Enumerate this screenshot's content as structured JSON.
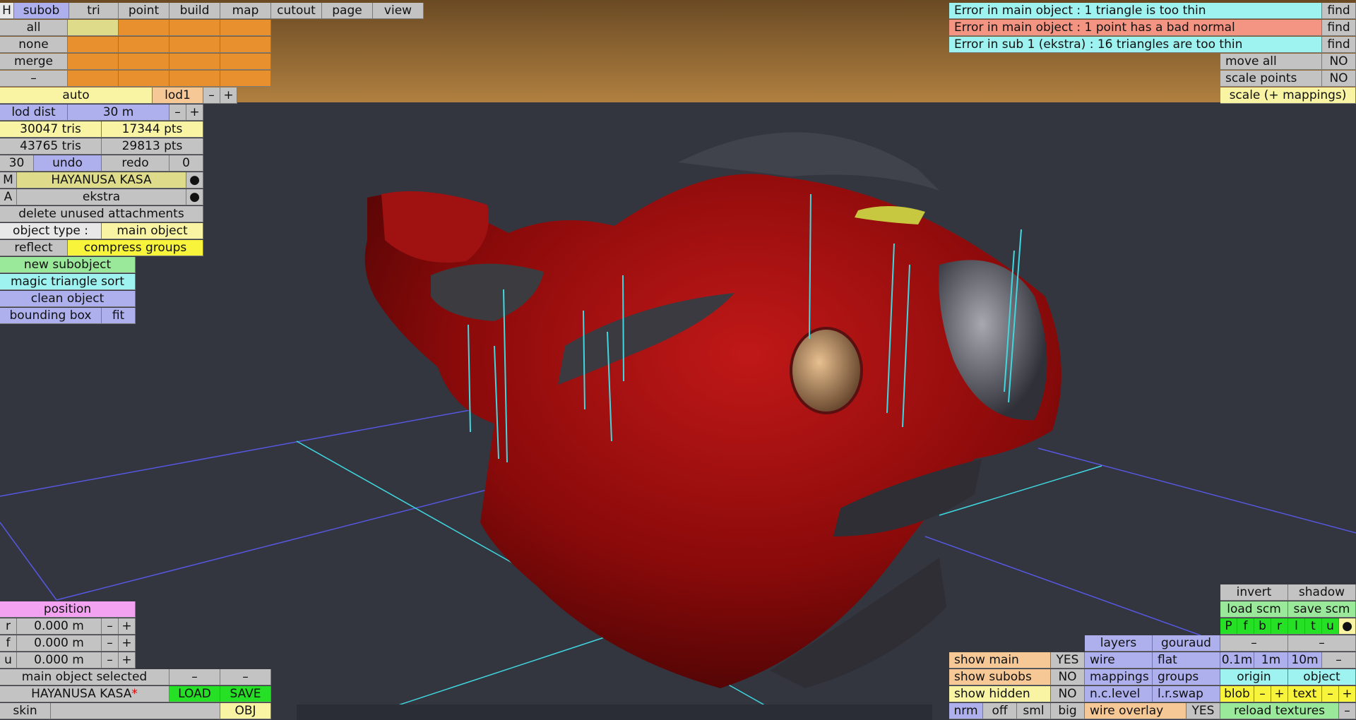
{
  "colors": {
    "background": "#33353f",
    "grid_blue": "#5658e0",
    "grid_cyan": "#40d8e0",
    "bike_red": "#8a0a0a",
    "sky_top": "#6a4a24",
    "sky_bottom": "#b08040"
  },
  "topmenu": {
    "h": "H",
    "items": [
      "subob",
      "tri",
      "point",
      "build",
      "map",
      "cutout",
      "page",
      "view"
    ]
  },
  "sel": {
    "all": "all",
    "none": "none",
    "merge": "merge",
    "minus": "–"
  },
  "lod": {
    "auto": "auto",
    "lod1": "lod1",
    "minus": "–",
    "plus": "+",
    "dist_label": "lod dist",
    "dist_value": "30 m"
  },
  "stats": {
    "tris1": "30047 tris",
    "pts1": "17344 pts",
    "tris2": "43765 tris",
    "pts2": "29813 pts"
  },
  "undo": {
    "count": "30",
    "undo": "undo",
    "redo": "redo",
    "redo_count": "0"
  },
  "material": {
    "m": "M",
    "name": "HAYANUSA KASA",
    "dot": "●"
  },
  "attach": {
    "a": "A",
    "name": "ekstra",
    "dot": "●"
  },
  "left_buttons": {
    "delete_unused": "delete unused attachments",
    "object_type_label": "object type :",
    "object_type_value": "main object",
    "reflect": "reflect",
    "compress": "compress groups",
    "new_sub": "new subobject",
    "magic": "magic triangle sort",
    "clean": "clean object",
    "bbox": "bounding box",
    "fit": "fit"
  },
  "errors": [
    {
      "text": "Error in main object : 1 triangle is too thin",
      "find": "find"
    },
    {
      "text": "Error in main object : 1 point has a bad normal",
      "find": "find"
    },
    {
      "text": "Error in sub 1 (ekstra) : 16 triangles are too thin",
      "find": "find"
    }
  ],
  "right_top": {
    "move_all": "move all",
    "move_all_v": "NO",
    "scale_points": "scale points",
    "scale_points_v": "NO",
    "scale_map": "scale (+ mappings)"
  },
  "position": {
    "title": "position",
    "rows": [
      {
        "axis": "r",
        "value": "0.000 m"
      },
      {
        "axis": "f",
        "value": "0.000 m"
      },
      {
        "axis": "u",
        "value": "0.000 m"
      }
    ],
    "minus": "–",
    "plus": "+"
  },
  "file": {
    "selected": "main object selected",
    "dash": "–",
    "name": "HAYANUSA KASA",
    "star": "*",
    "load": "LOAD",
    "save": "SAVE",
    "skin": "skin",
    "obj": "OBJ"
  },
  "view_opts": {
    "show_main": "show main",
    "show_main_v": "YES",
    "show_subobs": "show subobs",
    "show_subobs_v": "NO",
    "show_hidden": "show hidden",
    "show_hidden_v": "NO",
    "layers": "layers",
    "gouraud": "gouraud",
    "wire": "wire",
    "flat": "flat",
    "mappings": "mappings",
    "groups": "groups",
    "nclevel": "n.c.level",
    "lrswap": "l.r.swap",
    "nrm": "nrm",
    "off": "off",
    "sml": "sml",
    "big": "big",
    "wire_overlay": "wire overlay",
    "wire_overlay_v": "YES",
    "invert": "invert",
    "shadow": "shadow",
    "load_scm": "load scm",
    "save_scm": "save scm",
    "letters": [
      "P",
      "f",
      "b",
      "r",
      "l",
      "t",
      "u",
      "●"
    ],
    "dash": "–",
    "g01": "0.1m",
    "g1": "1m",
    "g10": "10m",
    "origin": "origin",
    "object": "object",
    "blob": "blob",
    "text": "text",
    "minus": "–",
    "plus": "+",
    "reload": "reload textures"
  }
}
